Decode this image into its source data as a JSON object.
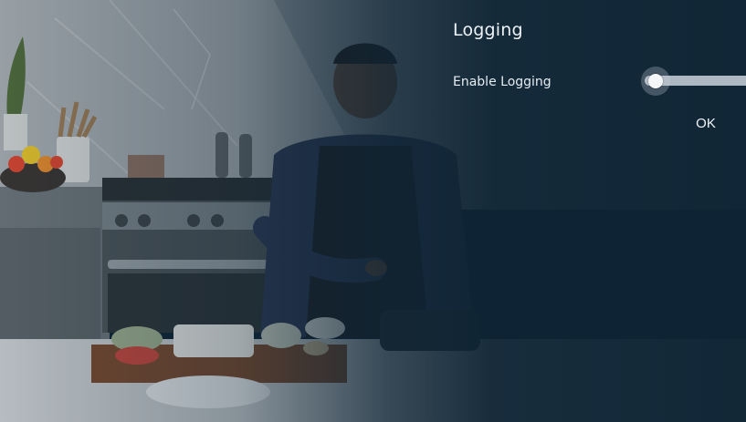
{
  "dialog": {
    "title": "Logging",
    "settings": [
      {
        "label": "Enable Logging",
        "enabled": false
      }
    ],
    "ok_label": "OK"
  },
  "colors": {
    "panel_background": "#0e2434",
    "text": "#eef2f6",
    "toggle_track": "#c9d2da",
    "toggle_knob": "#f4f6f8"
  }
}
